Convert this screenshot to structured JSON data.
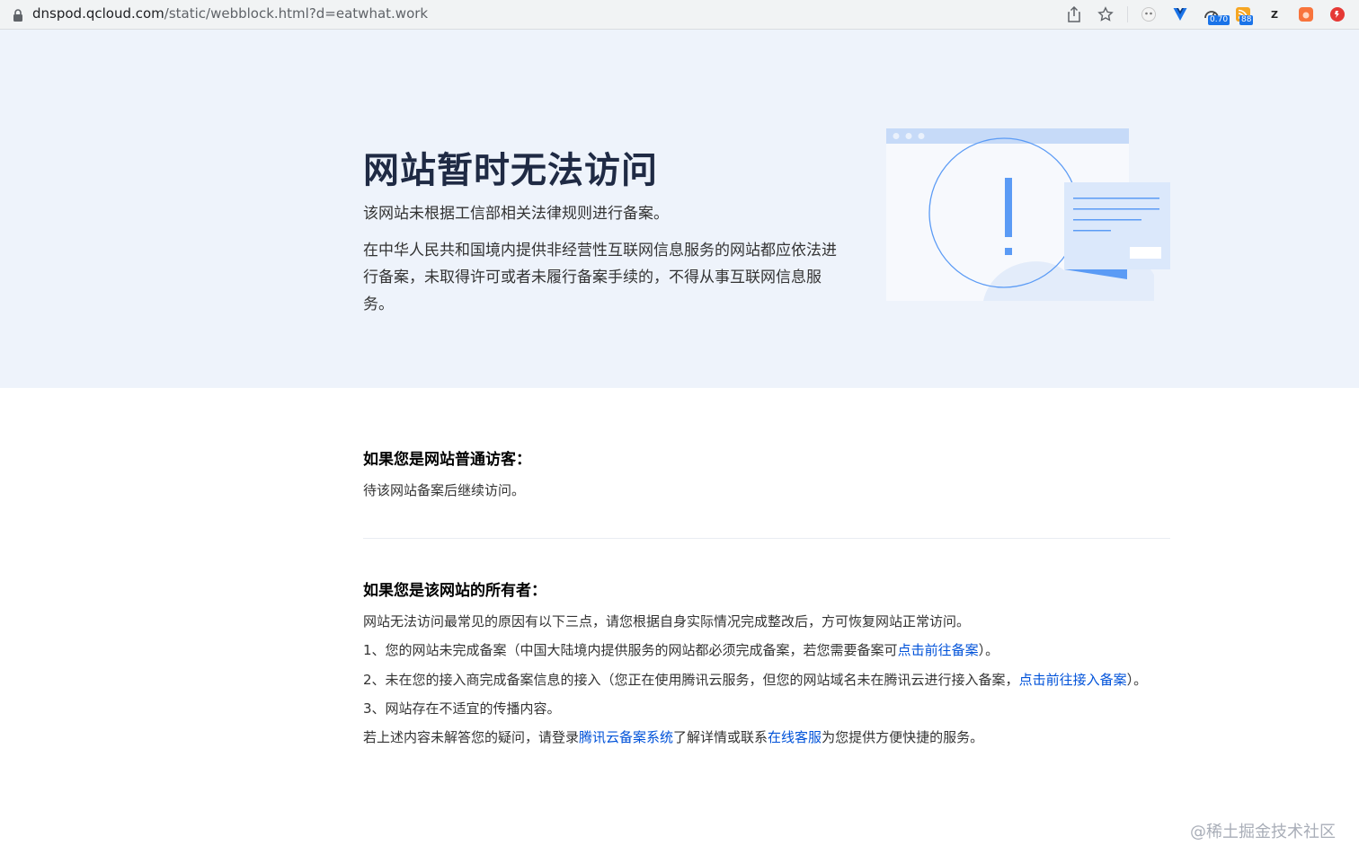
{
  "browser": {
    "url_host": "dnspod.qcloud.com",
    "url_path": "/static/webblock.html?d=eatwhat.work",
    "extension_badges": [
      "0.70",
      "88"
    ],
    "extension_letter": "Z",
    "icons": [
      "lock-icon",
      "share-icon",
      "star-icon",
      "extension-icon",
      "vue-devtools-icon",
      "gauge-icon",
      "rss-icon",
      "z-extension-icon",
      "flame-icon",
      "red-extension-icon"
    ]
  },
  "hero": {
    "title": "网站暂时无法访问",
    "subtitle": "该网站未根据工信部相关法律规则进行备案。",
    "description": "在中华人民共和国境内提供非经营性互联网信息服务的网站都应依法进行备案，未取得许可或者未履行备案手续的，不得从事互联网信息服务。"
  },
  "visitor": {
    "heading": "如果您是网站普通访客：",
    "text": "待该网站备案后继续访问。"
  },
  "owner": {
    "heading": "如果您是该网站的所有者：",
    "intro": "网站无法访问最常见的原因有以下三点，请您根据自身实际情况完成整改后，方可恢复网站正常访问。",
    "item1_pre": "1、您的网站未完成备案（中国大陆境内提供服务的网站都必须完成备案，若您需要备案可",
    "item1_link": "点击前往备案",
    "item1_post": "）。",
    "item2_pre": "2、未在您的接入商完成备案信息的接入（您正在使用腾讯云服务，但您的网站域名未在腾讯云进行接入备案，",
    "item2_link": "点击前往接入备案",
    "item2_post": "）。",
    "item3": "3、网站存在不适宜的传播内容。",
    "footer_pre": "若上述内容未解答您的疑问，请登录",
    "footer_link1": "腾讯云备案系统",
    "footer_mid": "了解详情或联系",
    "footer_link2": "在线客服",
    "footer_post": "为您提供方便快捷的服务。"
  },
  "watermark": "@稀土掘金技术社区",
  "colors": {
    "hero_bg": "#eef3fb",
    "link": "#0052d9",
    "title": "#1f2a44",
    "accent": "#5b9bf5"
  }
}
